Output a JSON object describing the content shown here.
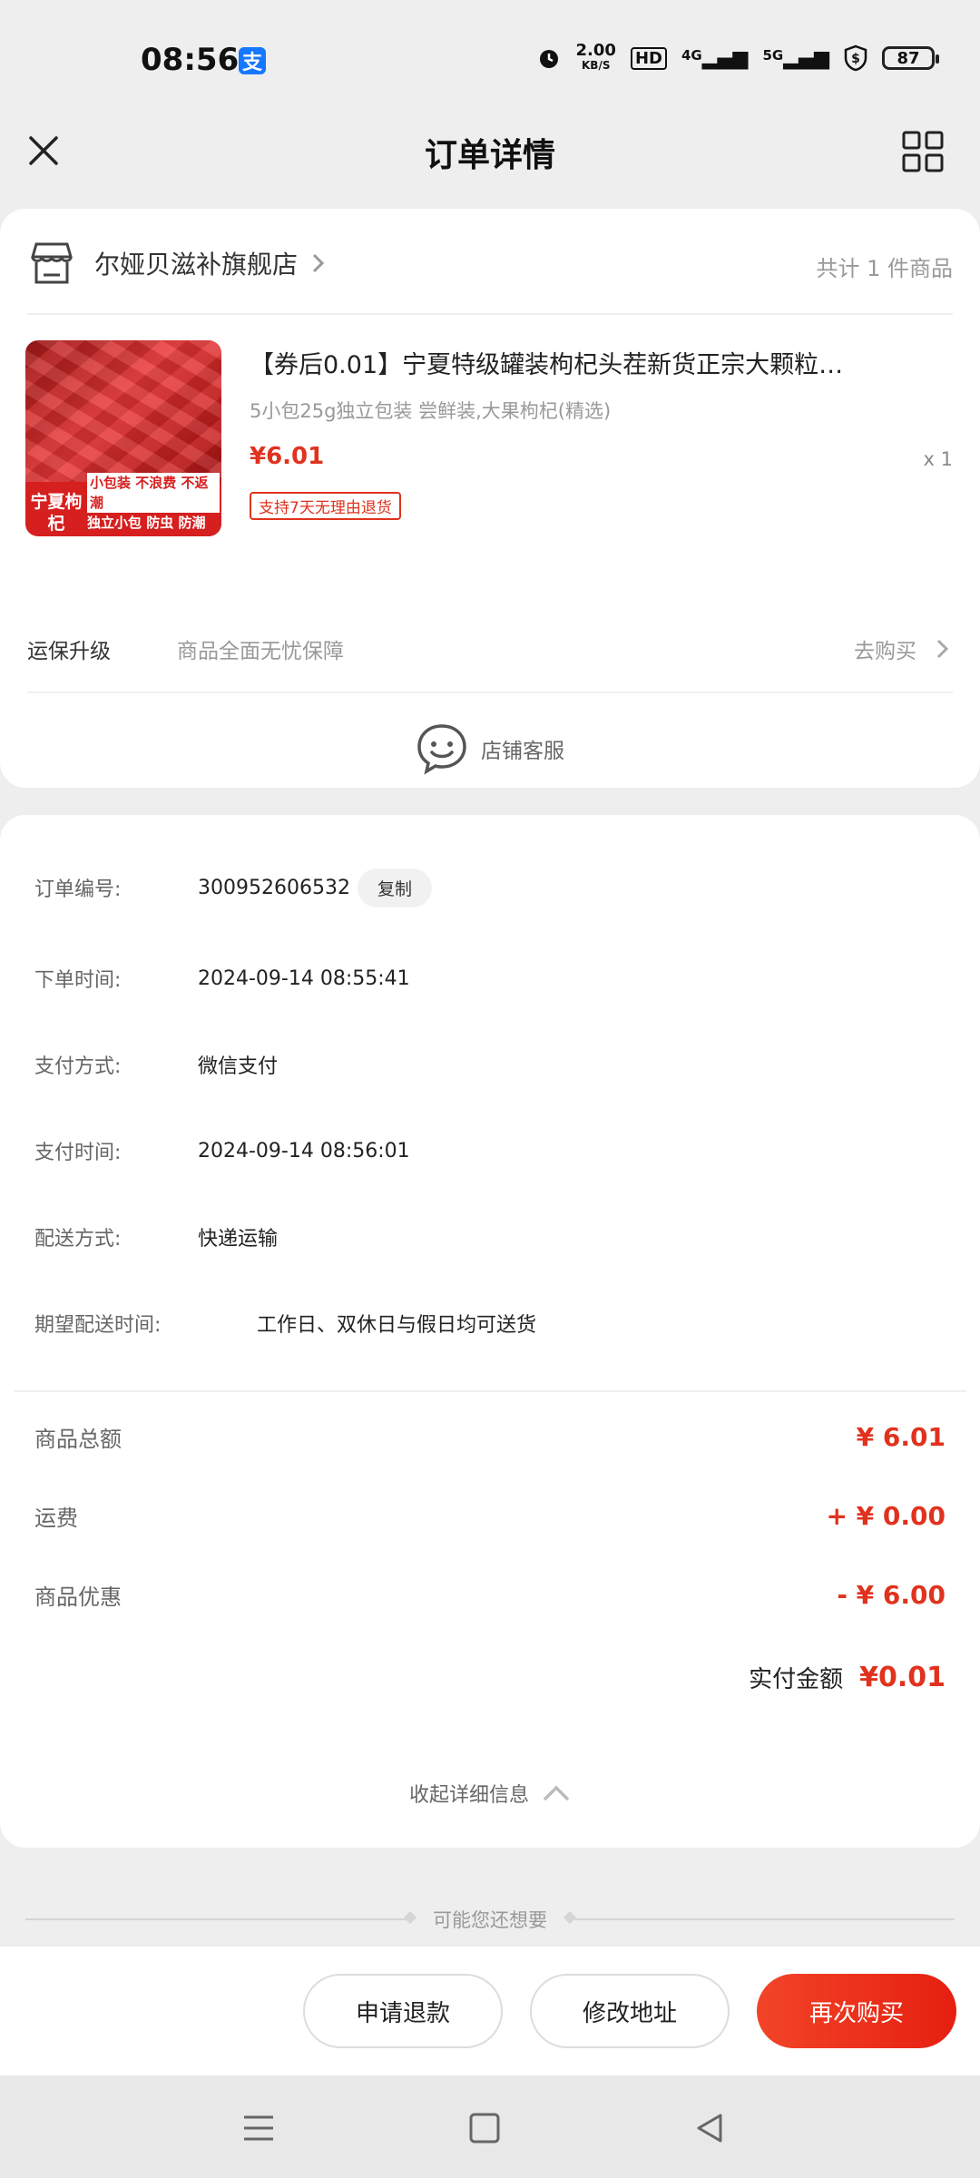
{
  "status_bar": {
    "time": "08:56",
    "app_badge": "支",
    "net_speed_top": "2.00",
    "net_speed_bottom": "KB/S",
    "hd": "HD",
    "net_4g": "4G",
    "net_5g": "5G",
    "battery": "87"
  },
  "header": {
    "title": "订单详情"
  },
  "shop": {
    "name": "尔娅贝滋补旗舰店",
    "total": "共计 1 件商品"
  },
  "product": {
    "title": "【券后0.01】宁夏特级罐装枸杞头茬新货正宗大颗粒…",
    "spec": "5小包25g独立包装 尝鲜装,大果枸杞(精选)",
    "price": "¥6.01",
    "qty": "x 1",
    "tag": "支持7天无理由退货",
    "img_tag_left": "宁夏枸杞",
    "img_tag_right_1": "小包装 不浪费 不返潮",
    "img_tag_right_2": "独立小包 防虫 防潮"
  },
  "insurance": {
    "label": "运保升级",
    "desc": "商品全面无忧保障",
    "link": "去购买"
  },
  "service": {
    "label": "店铺客服"
  },
  "order_info": {
    "order_no_label": "订单编号:",
    "order_no": "3009526065​32",
    "copy": "复制",
    "order_time_label": "下单时间:",
    "order_time": "2024-09-14 08:55:41",
    "pay_method_label": "支付方式:",
    "pay_method": "微信支付",
    "pay_time_label": "支付时间:",
    "pay_time": "2024-09-14 08:56:01",
    "delivery_label": "配送方式:",
    "delivery": "快递运输",
    "expect_label": "期望配送时间:",
    "expect": "工作日、双休日与假日均可送货"
  },
  "fees": {
    "goods_total_label": "商品总额",
    "goods_total": "¥ 6.01",
    "shipping_label": "运费",
    "shipping": "+ ¥ 0.00",
    "discount_label": "商品优惠",
    "discount": "- ¥ 6.00",
    "paid_label": "实付金额",
    "paid": "¥0.01"
  },
  "collapse": {
    "label": "收起详细信息"
  },
  "maybe": {
    "label": "可能您还想要"
  },
  "actions": {
    "refund": "申请退款",
    "address": "修改地址",
    "rebuy": "再次购买"
  },
  "colors": {
    "accent": "#e0321e",
    "background": "#eeeeee",
    "alipay": "#1677ff"
  }
}
